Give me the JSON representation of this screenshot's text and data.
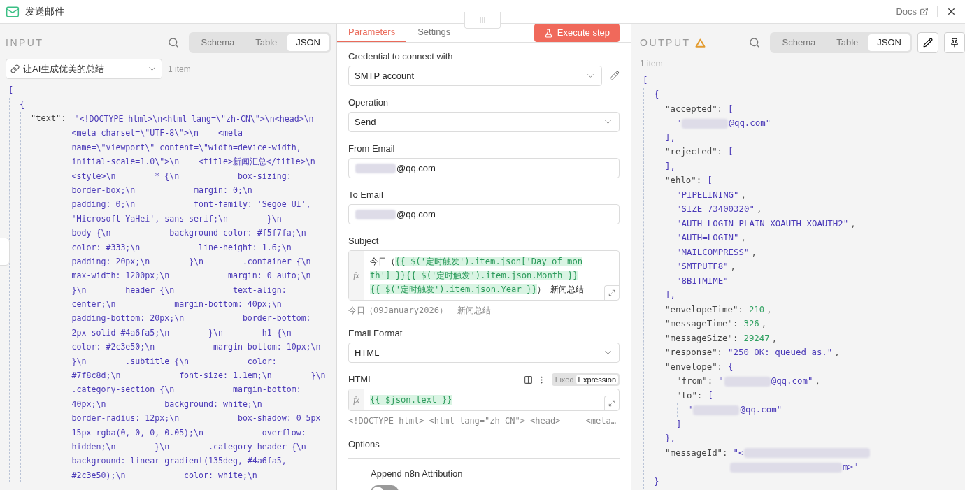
{
  "header": {
    "title": "发送邮件",
    "docs": "Docs"
  },
  "input": {
    "title": "INPUT",
    "view_tabs": [
      {
        "label": "Schema",
        "selected": false
      },
      {
        "label": "Table",
        "selected": false
      },
      {
        "label": "JSON",
        "selected": true
      }
    ],
    "source": "让AI生成优美的总结",
    "count": "1 item",
    "json": {
      "open": "[",
      "children": [
        {
          "open": "{",
          "children": [
            {
              "key": "\"text\":",
              "value_lines": [
                "\"<!DOCTYPE html>\\n<html lang=\\\"zh-CN\\\">\\n<head>\\n",
                "<meta charset=\\\"UTF-8\\\">\\n    <meta",
                "name=\\\"viewport\\\" content=\\\"width=device-width,",
                "initial-scale=1.0\\\">\\n    <title>新闻汇总</title>\\n",
                "<style>\\n        * {\\n            box-sizing:",
                "border-box;\\n            margin: 0;\\n",
                "padding: 0;\\n            font-family: 'Segoe UI',",
                "'Microsoft YaHei', sans-serif;\\n        }\\n",
                "body {\\n            background-color: #f5f7fa;\\n",
                "color: #333;\\n            line-height: 1.6;\\n",
                "padding: 20px;\\n        }\\n        .container {\\n",
                "max-width: 1200px;\\n            margin: 0 auto;\\n",
                "}\\n        header {\\n            text-align:",
                "center;\\n            margin-bottom: 40px;\\n",
                "padding-bottom: 20px;\\n            border-bottom:",
                "2px solid #4a6fa5;\\n        }\\n        h1 {\\n",
                "color: #2c3e50;\\n            margin-bottom: 10px;\\n",
                "}\\n        .subtitle {\\n            color:",
                "#7f8c8d;\\n            font-size: 1.1em;\\n        }\\n",
                ".category-section {\\n            margin-bottom:",
                "40px;\\n            background: white;\\n",
                "border-radius: 12px;\\n            box-shadow: 0 5px",
                "15px rgba(0, 0, 0, 0.05);\\n            overflow:",
                "hidden;\\n        }\\n        .category-header {\\n",
                "background: linear-gradient(135deg, #4a6fa5,",
                "#2c3e50);\\n            color: white;\\n"
              ]
            }
          ]
        }
      ]
    }
  },
  "editor": {
    "tabs": [
      {
        "label": "Parameters",
        "selected": true
      },
      {
        "label": "Settings",
        "selected": false
      }
    ],
    "execute": "Execute step",
    "fields": [
      {
        "kind": "select",
        "label": "Credential to connect with",
        "value": "SMTP account",
        "editable": true
      },
      {
        "kind": "select",
        "label": "Operation",
        "value": "Send"
      },
      {
        "kind": "input",
        "label": "From Email",
        "value": "@qq.com",
        "redacted": true
      },
      {
        "kind": "input",
        "label": "To Email",
        "value": "@qq.com",
        "redacted": true
      },
      {
        "kind": "expression",
        "label": "Subject",
        "fx": "fx",
        "segments": [
          {
            "kind": "plain",
            "text": "今日（"
          },
          {
            "kind": "expr",
            "text": "{{ $('定时触发').item.json['Day of month'] }}{{ $('定时触发').item.json.Month }}{{ $('定时触发').item.json.Year }}"
          },
          {
            "kind": "plain",
            "text": "）  新闻总结"
          }
        ],
        "preview": "今日（09January2026）  新闻总结"
      },
      {
        "kind": "select",
        "label": "Email Format",
        "value": "HTML"
      },
      {
        "kind": "expression",
        "label": "HTML",
        "fx": "fx",
        "modes": [
          {
            "label": "Fixed",
            "selected": false
          },
          {
            "label": "Expression",
            "selected": true
          }
        ],
        "segments": [
          {
            "kind": "expr",
            "text": "{{ $json.text }}"
          }
        ],
        "preview": "<!DOCTYPE html> <html lang=\"zh-CN\"> <head>     <meta…"
      }
    ],
    "options": {
      "title": "Options",
      "items": [
        {
          "label": "Append n8n Attribution",
          "on": false
        }
      ]
    }
  },
  "output": {
    "title": "OUTPUT",
    "warning": true,
    "view_tabs": [
      {
        "label": "Schema",
        "selected": false
      },
      {
        "label": "Table",
        "selected": false
      },
      {
        "label": "JSON",
        "selected": true
      }
    ],
    "count": "1 item",
    "json": {
      "open": "[",
      "children": [
        {
          "open": "{",
          "children": [
            {
              "key": "\"accepted\":",
              "open": "[",
              "children": [
                {
                  "prefix": "\"",
                  "value": "@qq.com\"",
                  "kind": "string",
                  "redacted": true
                }
              ],
              "close": "],"
            },
            {
              "key": "\"rejected\":",
              "open": "[",
              "close": "],"
            },
            {
              "key": "\"ehlo\":",
              "open": "[",
              "children": [
                {
                  "value": "\"PIPELINING\"",
                  "kind": "string",
                  "tail": ","
                },
                {
                  "value": "\"SIZE 73400320\"",
                  "kind": "string",
                  "tail": ","
                },
                {
                  "value": "\"AUTH LOGIN PLAIN XOAUTH XOAUTH2\"",
                  "kind": "string",
                  "tail": ","
                },
                {
                  "value": "\"AUTH=LOGIN\"",
                  "kind": "string",
                  "tail": ","
                },
                {
                  "value": "\"MAILCOMPRESS\"",
                  "kind": "string",
                  "tail": ","
                },
                {
                  "value": "\"SMTPUTF8\"",
                  "kind": "string",
                  "tail": ","
                },
                {
                  "value": "\"8BITMIME\"",
                  "kind": "string"
                }
              ],
              "close": "],"
            },
            {
              "key": "\"envelopeTime\":",
              "value": "210",
              "kind": "number",
              "tail": ","
            },
            {
              "key": "\"messageTime\":",
              "value": "326",
              "kind": "number",
              "tail": ","
            },
            {
              "key": "\"messageSize\":",
              "value": "29247",
              "kind": "number",
              "tail": ","
            },
            {
              "key": "\"response\":",
              "value": "\"250 OK: queued as.\"",
              "kind": "string",
              "tail": ","
            },
            {
              "key": "\"envelope\":",
              "open": "{",
              "children": [
                {
                  "key": "\"from\":",
                  "prefix": "\"",
                  "value": "@qq.com\"",
                  "kind": "string",
                  "redacted": true,
                  "tail": ","
                },
                {
                  "key": "\"to\":",
                  "open": "[",
                  "children": [
                    {
                      "prefix": "\"",
                      "value": "@qq.com\"",
                      "kind": "string",
                      "redacted": true
                    }
                  ],
                  "close": "]"
                }
              ],
              "close": "},"
            },
            {
              "key": "\"messageId\":",
              "value": "\"<",
              "kind": "string",
              "redacted": true,
              "wrap": "m>\""
            }
          ],
          "close": "}"
        }
      ]
    }
  }
}
